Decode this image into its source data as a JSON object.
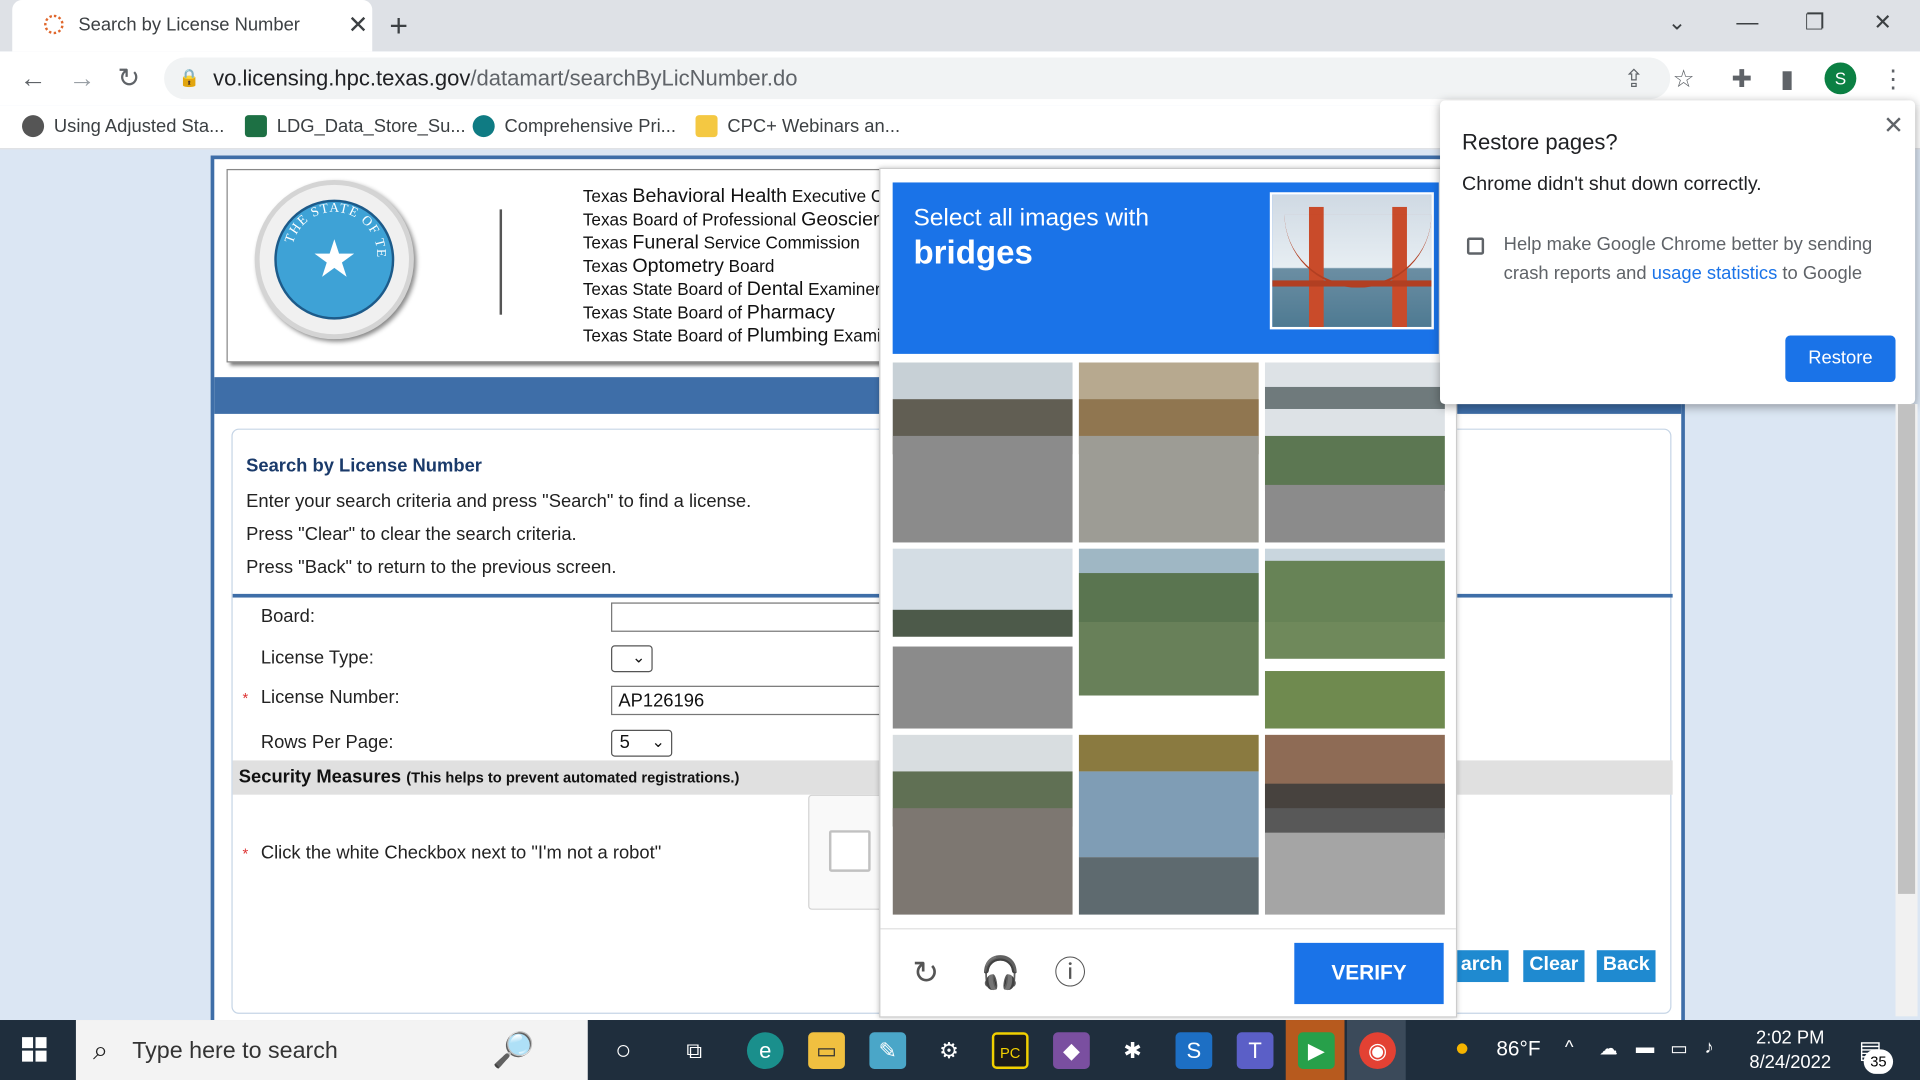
{
  "browser": {
    "tab_title": "Search by License Number",
    "url_host": "vo.licensing.hpc.texas.gov",
    "url_path": "/datamart/searchByLicNumber.do",
    "bookmarks": [
      "Using Adjusted Sta...",
      "LDG_Data_Store_Su...",
      "Comprehensive Pri...",
      "CPC+ Webinars an..."
    ],
    "profile_initial": "S"
  },
  "header": {
    "boards": [
      {
        "pre": "Texas ",
        "big": "Behavioral Health",
        "post": " Executive Co"
      },
      {
        "pre": "Texas Board of Professional ",
        "big": "Geoscient",
        "post": ""
      },
      {
        "pre": "Texas ",
        "big": "Funeral",
        "post": " Service Commission"
      },
      {
        "pre": "Texas ",
        "big": "Optometry",
        "post": " Board"
      },
      {
        "pre": "Texas State Board of ",
        "big": "Dental",
        "post": " Examiners"
      },
      {
        "pre": "Texas State Board of ",
        "big": "Pharmacy",
        "post": ""
      },
      {
        "pre": "Texas State Board of ",
        "big": "Plumbing",
        "post": " Examir"
      }
    ],
    "seal_text": "THE STATE OF TEXAS"
  },
  "form": {
    "title": "Search by License Number",
    "instructions": [
      "Enter your search criteria and press \"Search\" to find a license.",
      "Press \"Clear\" to clear the search criteria.",
      "Press \"Back\" to return to the previous screen."
    ],
    "board_label": "Board:",
    "board_value": "",
    "license_type_label": "License Type:",
    "license_type_value": "",
    "license_number_label": "License Number:",
    "license_number_value": "AP126196",
    "rows_label": "Rows Per Page:",
    "rows_value": "5",
    "required_mark": "*",
    "security_title": "Security Measures",
    "security_note": "(This helps to prevent automated registrations.)",
    "robot_instruction": "Click the white Checkbox next to \"I'm not a robot\"",
    "search_label": "arch",
    "clear_label": "Clear",
    "back_label": "Back"
  },
  "captcha": {
    "prompt_small": "Select all images with",
    "prompt_big": "bridges",
    "verify_label": "VERIFY"
  },
  "restore_popup": {
    "title": "Restore pages?",
    "message": "Chrome didn't shut down correctly.",
    "checkbox_text": "Help make Google Chrome better by sending crash reports and",
    "link_text": "usage statistics",
    "checkbox_text_end": "to Google",
    "button_label": "Restore"
  },
  "taskbar": {
    "search_placeholder": "Type here to search",
    "weather": "86°F",
    "time": "2:02 PM",
    "date": "8/24/2022",
    "notification_count": "35"
  }
}
